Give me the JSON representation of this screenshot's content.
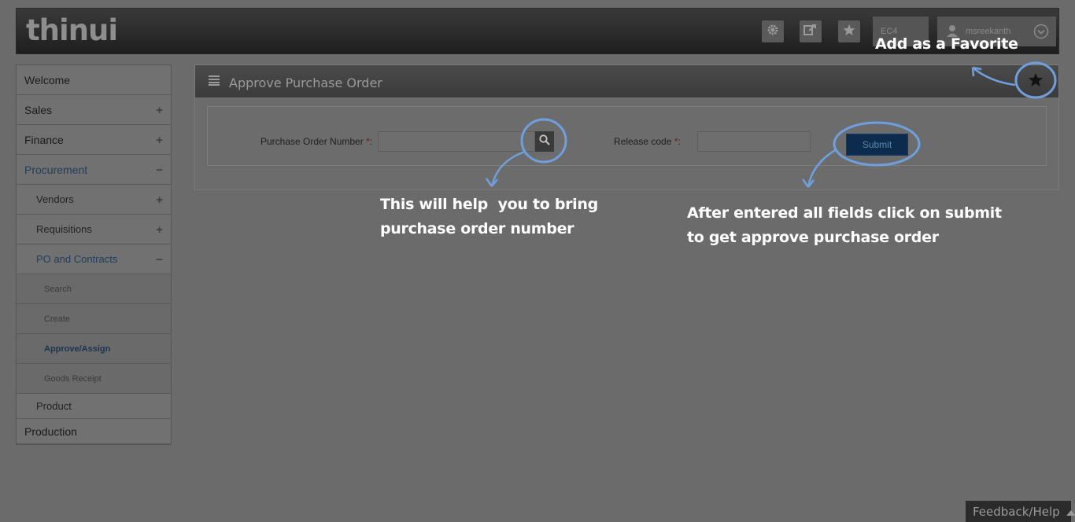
{
  "header": {
    "logo_text": "thinui",
    "company": "EC4",
    "username": "msreekanth",
    "icons": [
      "gear-icon",
      "export-icon",
      "star-icon",
      "user-icon",
      "chevron-down-icon"
    ]
  },
  "sidebar": {
    "items": [
      {
        "label": "Welcome",
        "sign": ""
      },
      {
        "label": "Sales",
        "sign": "+"
      },
      {
        "label": "Finance",
        "sign": "+"
      },
      {
        "label": "Procurement",
        "sign": "−"
      },
      {
        "label": "Vendors",
        "sign": "+"
      },
      {
        "label": "Requisitions",
        "sign": "+"
      },
      {
        "label": "PO and Contracts",
        "sign": "−"
      },
      {
        "label": "Search",
        "sign": ""
      },
      {
        "label": "Create",
        "sign": ""
      },
      {
        "label": "Approve/Assign",
        "sign": ""
      },
      {
        "label": "Goods Receipt",
        "sign": ""
      },
      {
        "label": "Product",
        "sign": ""
      },
      {
        "label": "Production",
        "sign": ""
      }
    ]
  },
  "panel": {
    "title": "Approve Purchase Order",
    "po_label": "Purchase Order Number",
    "release_label": "Release code",
    "required_mark": "*",
    "colon": ":",
    "po_value": "",
    "release_value": "",
    "submit_label": "Submit"
  },
  "annotations": {
    "favorite": "Add as a Favorite",
    "search_line1": "This will help  you to bring",
    "search_line2": "purchase order number",
    "submit_line1": "After entered all fields click on submit",
    "submit_line2": "to get approve purchase order",
    "highlight_color": "#6fa0dd"
  },
  "feedback": {
    "label": "Feedback/Help"
  }
}
